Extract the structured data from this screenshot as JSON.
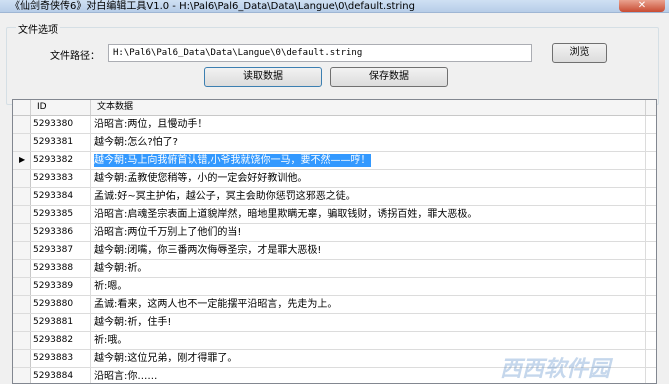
{
  "window": {
    "title": "《仙剑奇侠传6》对白编辑工具V1.0 - H:\\Pal6\\Pal6_Data\\Data\\Langue\\0\\default.string"
  },
  "file_group": {
    "label": "文件选项",
    "path_label": "文件路径：",
    "path_value": "H:\\Pal6\\Pal6_Data\\Data\\Langue\\0\\default.string",
    "browse_label": "浏览",
    "read_label": "读取数据",
    "save_label": "保存数据"
  },
  "grid": {
    "headers": {
      "id": "ID",
      "text": "文本数据"
    },
    "rows": [
      {
        "id": "5293380",
        "text": "沿昭言:两位，且慢动手！"
      },
      {
        "id": "5293381",
        "text": "越今朝:怎么?怕了?"
      },
      {
        "id": "5293382",
        "text": "越今朝:马上向我俯首认错,小爷我就饶你一马，要不然——哼！",
        "selected": true
      },
      {
        "id": "5293383",
        "text": "越今朝:孟教使您稍等，小的一定会好好教训他。"
      },
      {
        "id": "5293384",
        "text": "孟诚:好~冥主护佑，越公子，冥主会助你惩罚这邪恶之徒。"
      },
      {
        "id": "5293385",
        "text": "沿昭言:启魂圣宗表面上道貌岸然，暗地里欺瞒无辜，骗取钱财，诱拐百姓，罪大恶极。"
      },
      {
        "id": "5293386",
        "text": "沿昭言:两位千万别上了他们的当!"
      },
      {
        "id": "5293387",
        "text": "越今朝:闭嘴，你三番两次侮辱圣宗，才是罪大恶极!"
      },
      {
        "id": "5293388",
        "text": "越今朝:祈。"
      },
      {
        "id": "5293389",
        "text": "祈:嗯。"
      },
      {
        "id": "5293880",
        "text": "孟诚:看来，这两人也不一定能摆平沿昭言，先走为上。"
      },
      {
        "id": "5293881",
        "text": "越今朝:祈，住手!"
      },
      {
        "id": "5293882",
        "text": "祈:哦。"
      },
      {
        "id": "5293883",
        "text": "越今朝:这位兄弟，刚才得罪了。"
      },
      {
        "id": "5293884",
        "text": "沿昭言:你……"
      }
    ]
  },
  "watermark": "西西软件园"
}
